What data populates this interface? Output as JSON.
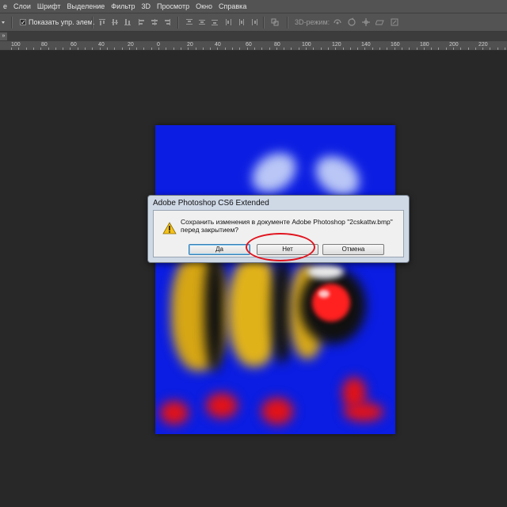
{
  "menubar": {
    "items": [
      "е",
      "Слои",
      "Шрифт",
      "Выделение",
      "Фильтр",
      "3D",
      "Просмотр",
      "Окно",
      "Справка"
    ]
  },
  "optionsbar": {
    "show_controls_checked": true,
    "show_controls_label": "Показать упр. элем.",
    "mode_label": "3D-режим:",
    "mode_icons": [
      "rotate-3d-icon",
      "roll-3d-icon",
      "pan-3d-icon",
      "slide-3d-icon",
      "scale-3d-icon"
    ]
  },
  "ruler": {
    "labels": [
      "100",
      "80",
      "60",
      "40",
      "20",
      "0",
      "20",
      "40",
      "60",
      "80",
      "100",
      "120",
      "140",
      "160",
      "180",
      "200",
      "220"
    ]
  },
  "dialog": {
    "title": "Adobe Photoshop CS6 Extended",
    "message_line1": "Сохранить изменения в документе Adobe Photoshop \"2cskattw.bmp\"",
    "message_line2": "перед закрытием?",
    "icon": "warning-icon",
    "buttons": {
      "yes": "Да",
      "no": "Нет",
      "cancel": "Отмена"
    },
    "highlighted_button": "no"
  },
  "colors": {
    "app_background": "#282828",
    "chrome": "#535353",
    "canvas_background": "#0b1de2",
    "highlight": "#e0141e"
  }
}
